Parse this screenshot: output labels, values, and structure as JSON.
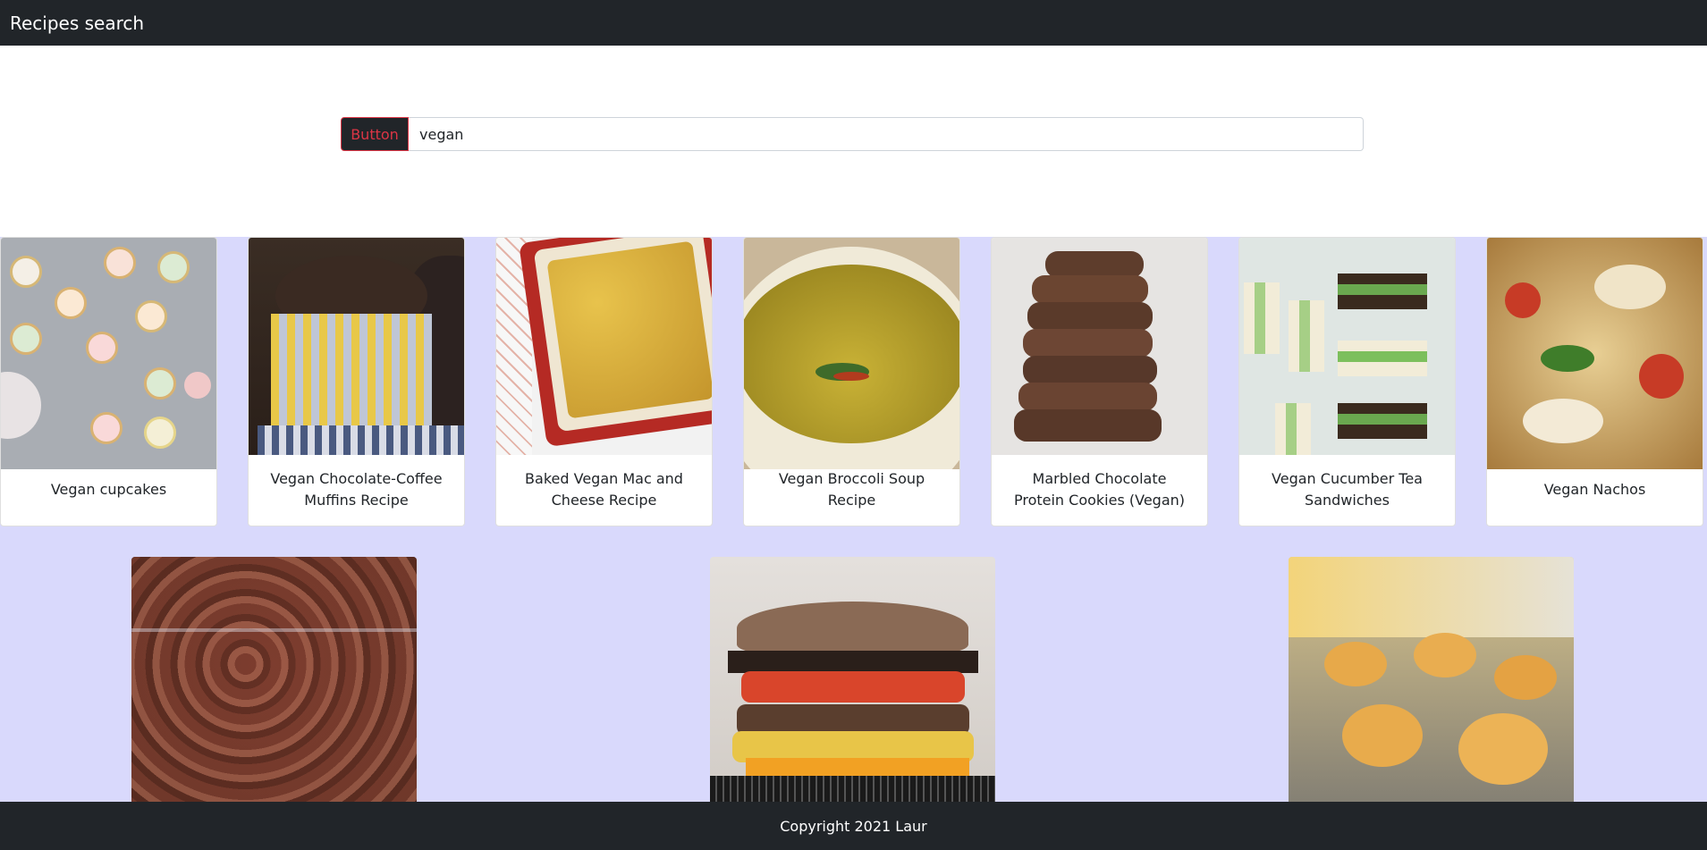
{
  "navbar": {
    "brand": "Recipes search"
  },
  "search": {
    "button_label": "Button",
    "value": "vegan"
  },
  "recipes": [
    {
      "title": "Vegan cupcakes"
    },
    {
      "title": "Vegan Chocolate-Coffee Muffins Recipe"
    },
    {
      "title": "Baked Vegan Mac and Cheese Recipe"
    },
    {
      "title": "Vegan Broccoli Soup Recipe"
    },
    {
      "title": "Marbled Chocolate Protein Cookies (Vegan)"
    },
    {
      "title": "Vegan Cucumber Tea Sandwiches"
    },
    {
      "title": "Vegan Nachos"
    }
  ],
  "footer": {
    "copyright": "Copyright 2021 Laur"
  }
}
